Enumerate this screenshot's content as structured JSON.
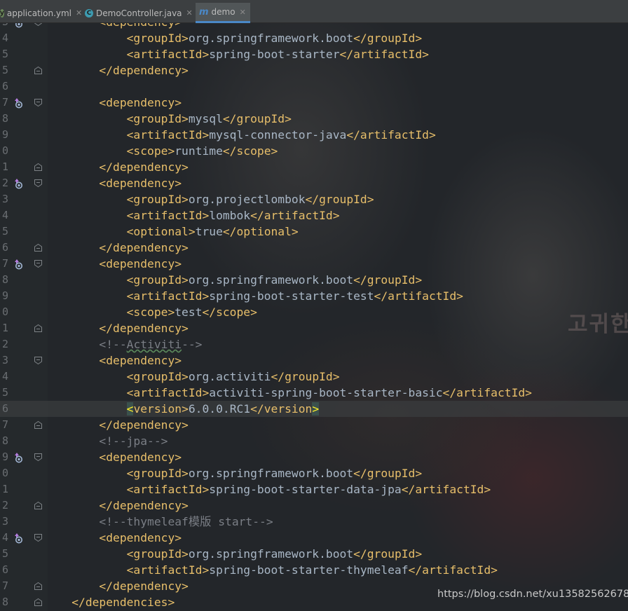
{
  "tabs": [
    {
      "label": "application.yml",
      "icon": "yaml-file-icon",
      "active": false
    },
    {
      "label": "DemoController.java",
      "icon": "java-class-icon",
      "active": false
    },
    {
      "label": "demo",
      "icon": "maven-file-icon",
      "active": true
    }
  ],
  "editor": {
    "caret_line_index": 24,
    "lines": [
      {
        "n": "3",
        "gutter": "override",
        "fold": "open",
        "segs": [
          [
            "t",
            "        <dependency>"
          ]
        ]
      },
      {
        "n": "4",
        "segs": [
          [
            "t",
            "            <groupId>"
          ],
          [
            "tx",
            "org.springframework.boot"
          ],
          [
            "t",
            "</groupId>"
          ]
        ]
      },
      {
        "n": "5",
        "segs": [
          [
            "t",
            "            <artifactId>"
          ],
          [
            "tx",
            "spring-boot-starter"
          ],
          [
            "t",
            "</artifactId>"
          ]
        ]
      },
      {
        "n": "5",
        "fold": "close",
        "segs": [
          [
            "t",
            "        </dependency>"
          ]
        ]
      },
      {
        "n": "6",
        "segs": []
      },
      {
        "n": "7",
        "gutter": "override",
        "fold": "open",
        "segs": [
          [
            "t",
            "        <dependency>"
          ]
        ]
      },
      {
        "n": "8",
        "segs": [
          [
            "t",
            "            <groupId>"
          ],
          [
            "tx",
            "mysql"
          ],
          [
            "t",
            "</groupId>"
          ]
        ]
      },
      {
        "n": "9",
        "segs": [
          [
            "t",
            "            <artifactId>"
          ],
          [
            "tx",
            "mysql-connector-java"
          ],
          [
            "t",
            "</artifactId>"
          ]
        ]
      },
      {
        "n": "0",
        "segs": [
          [
            "t",
            "            <scope>"
          ],
          [
            "tx",
            "runtime"
          ],
          [
            "t",
            "</scope>"
          ]
        ]
      },
      {
        "n": "1",
        "fold": "close",
        "segs": [
          [
            "t",
            "        </dependency>"
          ]
        ]
      },
      {
        "n": "2",
        "gutter": "override",
        "fold": "open",
        "segs": [
          [
            "t",
            "        <dependency>"
          ]
        ]
      },
      {
        "n": "3",
        "segs": [
          [
            "t",
            "            <groupId>"
          ],
          [
            "tx",
            "org.projectlombok"
          ],
          [
            "t",
            "</groupId>"
          ]
        ]
      },
      {
        "n": "4",
        "segs": [
          [
            "t",
            "            <artifactId>"
          ],
          [
            "tx",
            "lombok"
          ],
          [
            "t",
            "</artifactId>"
          ]
        ]
      },
      {
        "n": "5",
        "segs": [
          [
            "t",
            "            <optional>"
          ],
          [
            "tx",
            "true"
          ],
          [
            "t",
            "</optional>"
          ]
        ]
      },
      {
        "n": "6",
        "fold": "close",
        "segs": [
          [
            "t",
            "        </dependency>"
          ]
        ]
      },
      {
        "n": "7",
        "gutter": "override",
        "fold": "open",
        "segs": [
          [
            "t",
            "        <dependency>"
          ]
        ]
      },
      {
        "n": "8",
        "segs": [
          [
            "t",
            "            <groupId>"
          ],
          [
            "tx",
            "org.springframework.boot"
          ],
          [
            "t",
            "</groupId>"
          ]
        ]
      },
      {
        "n": "9",
        "segs": [
          [
            "t",
            "            <artifactId>"
          ],
          [
            "tx",
            "spring-boot-starter-test"
          ],
          [
            "t",
            "</artifactId>"
          ]
        ]
      },
      {
        "n": "0",
        "segs": [
          [
            "t",
            "            <scope>"
          ],
          [
            "tx",
            "test"
          ],
          [
            "t",
            "</scope>"
          ]
        ]
      },
      {
        "n": "1",
        "fold": "close",
        "segs": [
          [
            "t",
            "        </dependency>"
          ]
        ]
      },
      {
        "n": "2",
        "segs": [
          [
            "cm",
            "        <!--"
          ],
          [
            "cm sq",
            "Activiti"
          ],
          [
            "cm",
            "-->"
          ]
        ]
      },
      {
        "n": "3",
        "fold": "open",
        "segs": [
          [
            "t",
            "        <dependency>"
          ]
        ]
      },
      {
        "n": "4",
        "segs": [
          [
            "t",
            "            <groupId>"
          ],
          [
            "tx",
            "org.activiti"
          ],
          [
            "t",
            "</groupId>"
          ]
        ]
      },
      {
        "n": "5",
        "segs": [
          [
            "t",
            "            <artifactId>"
          ],
          [
            "tx",
            "activiti-spring-boot-starter-basic"
          ],
          [
            "t",
            "</artifactId>"
          ]
        ]
      },
      {
        "n": "6",
        "segs": [
          [
            "tx",
            "            "
          ],
          [
            "hl",
            "<"
          ],
          [
            "t",
            "version>"
          ],
          [
            "tx",
            "6.0.0.RC1"
          ],
          [
            "t",
            "</version"
          ],
          [
            "hl",
            ">"
          ]
        ]
      },
      {
        "n": "7",
        "fold": "close",
        "segs": [
          [
            "t",
            "        </dependency>"
          ]
        ]
      },
      {
        "n": "8",
        "segs": [
          [
            "cm",
            "        <!--jpa-->"
          ]
        ]
      },
      {
        "n": "9",
        "gutter": "override",
        "fold": "open",
        "segs": [
          [
            "t",
            "        <dependency>"
          ]
        ]
      },
      {
        "n": "0",
        "segs": [
          [
            "t",
            "            <groupId>"
          ],
          [
            "tx",
            "org.springframework.boot"
          ],
          [
            "t",
            "</groupId>"
          ]
        ]
      },
      {
        "n": "1",
        "segs": [
          [
            "t",
            "            <artifactId>"
          ],
          [
            "tx",
            "spring-boot-starter-data-jpa"
          ],
          [
            "t",
            "</artifactId>"
          ]
        ]
      },
      {
        "n": "2",
        "fold": "close",
        "segs": [
          [
            "t",
            "        </dependency>"
          ]
        ]
      },
      {
        "n": "3",
        "segs": [
          [
            "cm",
            "        <!--thymeleaf模版 start-->"
          ]
        ]
      },
      {
        "n": "4",
        "gutter": "override",
        "fold": "open",
        "segs": [
          [
            "t",
            "        <dependency>"
          ]
        ]
      },
      {
        "n": "5",
        "segs": [
          [
            "t",
            "            <groupId>"
          ],
          [
            "tx",
            "org.springframework.boot"
          ],
          [
            "t",
            "</groupId>"
          ]
        ]
      },
      {
        "n": "6",
        "segs": [
          [
            "t",
            "            <artifactId>"
          ],
          [
            "tx",
            "spring-boot-starter-thymeleaf"
          ],
          [
            "t",
            "</artifactId>"
          ]
        ]
      },
      {
        "n": "7",
        "fold": "close",
        "segs": [
          [
            "t",
            "        </dependency>"
          ]
        ]
      },
      {
        "n": "8",
        "fold": "close",
        "segs": [
          [
            "t",
            "    </dependencies>"
          ]
        ]
      }
    ]
  },
  "watermark": "https://blog.csdn.net/xu13582562678",
  "background_text": "고귀한 별들이 붉게 물들",
  "colors": {
    "tag": "#e8bf6a",
    "text": "#a9b7c6",
    "comment": "#7a7e85",
    "bracket_match": "#ffef28",
    "tab_active_underline": "#4a88c7",
    "override_icon": "#a2b6d4"
  }
}
